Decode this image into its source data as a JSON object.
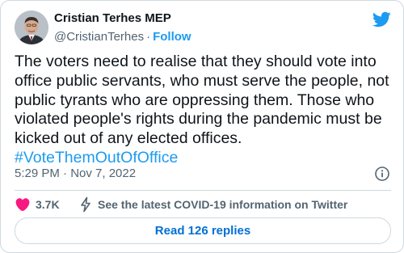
{
  "author": {
    "name": "Cristian Terhes MEP",
    "handle": "@CristianTerhes",
    "separator": "·",
    "follow_label": "Follow"
  },
  "tweet": {
    "text": "The voters need to realise that they should vote into office public servants, who must serve the people, not public tyrants who are oppressing them. Those who violated people's rights during the pandemic must be kicked out of any elected offices.",
    "hashtag": "#VoteThemOutOfOffice",
    "time": "5:29 PM · Nov 7, 2022"
  },
  "actions": {
    "likes": "3.7K",
    "covid_info": "See the latest COVID-19 information on Twitter"
  },
  "replies_button": "Read 126 replies",
  "icons": {
    "brand": "twitter-bird-icon",
    "info": "info-icon",
    "like": "heart-icon",
    "covid": "lightning-bolt-icon"
  },
  "colors": {
    "accent": "#1d9bf0",
    "like": "#f91880",
    "text": "#0f1419",
    "secondary": "#536471",
    "border": "#cfd9de"
  }
}
